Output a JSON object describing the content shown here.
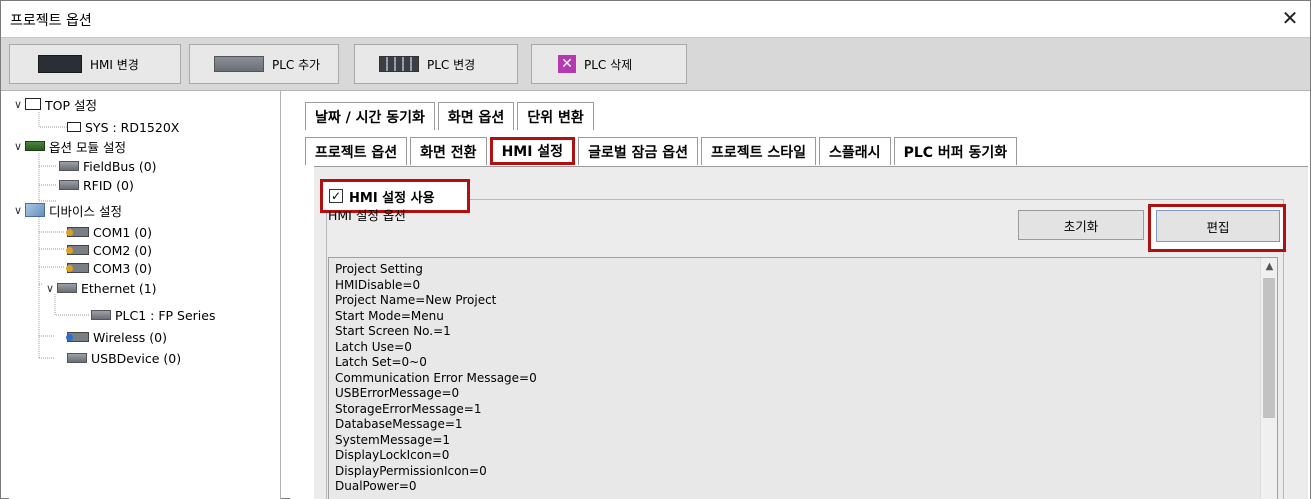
{
  "window": {
    "title": "프로젝트 옵션",
    "close_glyph": "✕"
  },
  "toolbar": {
    "buttons": [
      {
        "label": "HMI 변경",
        "icon": "hmi-icon"
      },
      {
        "label": "PLC 추가",
        "icon": "plc-add-icon"
      },
      {
        "label": "PLC 변경",
        "icon": "plc-change-icon"
      },
      {
        "label": "PLC 삭제",
        "icon": "plc-delete-icon",
        "glyph": "✕"
      }
    ]
  },
  "tree": {
    "chevron_open": "∨",
    "items": [
      {
        "label": "TOP 설정",
        "expanded": true
      },
      {
        "label": "SYS : RD1520X"
      },
      {
        "label": "옵션 모듈 설정",
        "expanded": true
      },
      {
        "label": "FieldBus (0)"
      },
      {
        "label": "RFID (0)"
      },
      {
        "label": "디바이스 설정",
        "expanded": true
      },
      {
        "label": "COM1 (0)"
      },
      {
        "label": "COM2 (0)"
      },
      {
        "label": "COM3 (0)"
      },
      {
        "label": "Ethernet (1)",
        "expanded": true
      },
      {
        "label": "PLC1 : FP Series"
      },
      {
        "label": "Wireless (0)"
      },
      {
        "label": "USBDevice (0)"
      }
    ]
  },
  "tabs_row1": [
    "날짜 / 시간 동기화",
    "화면 옵션",
    "단위 변환"
  ],
  "tabs_row2": [
    "프로젝트 옵션",
    "화면 전환",
    "HMI 설정",
    "글로벌 잠금 옵션",
    "프로젝트 스타일",
    "스플래시",
    "PLC 버퍼 동기화"
  ],
  "active_tab": "HMI 설정",
  "hmi_settings": {
    "enable_label": "HMI 설정 사용",
    "enable_checked": true,
    "check_glyph": "✓",
    "group_label": "HMI 설정 옵션",
    "reset_label": "초기화",
    "edit_label": "편집",
    "lines": [
      "Project Setting",
      "HMIDisable=0",
      "Project Name=New Project",
      "Start Mode=Menu",
      "Start Screen No.=1",
      "Latch Use=0",
      "Latch Set=0~0",
      "Communication Error Message=0",
      "USBErrorMessage=0",
      "StorageErrorMessage=1",
      "DatabaseMessage=1",
      "SystemMessage=1",
      "DisplayLockIcon=0",
      "DisplayPermissionIcon=0",
      "DualPower=0"
    ],
    "scroll_up_glyph": "▲"
  }
}
